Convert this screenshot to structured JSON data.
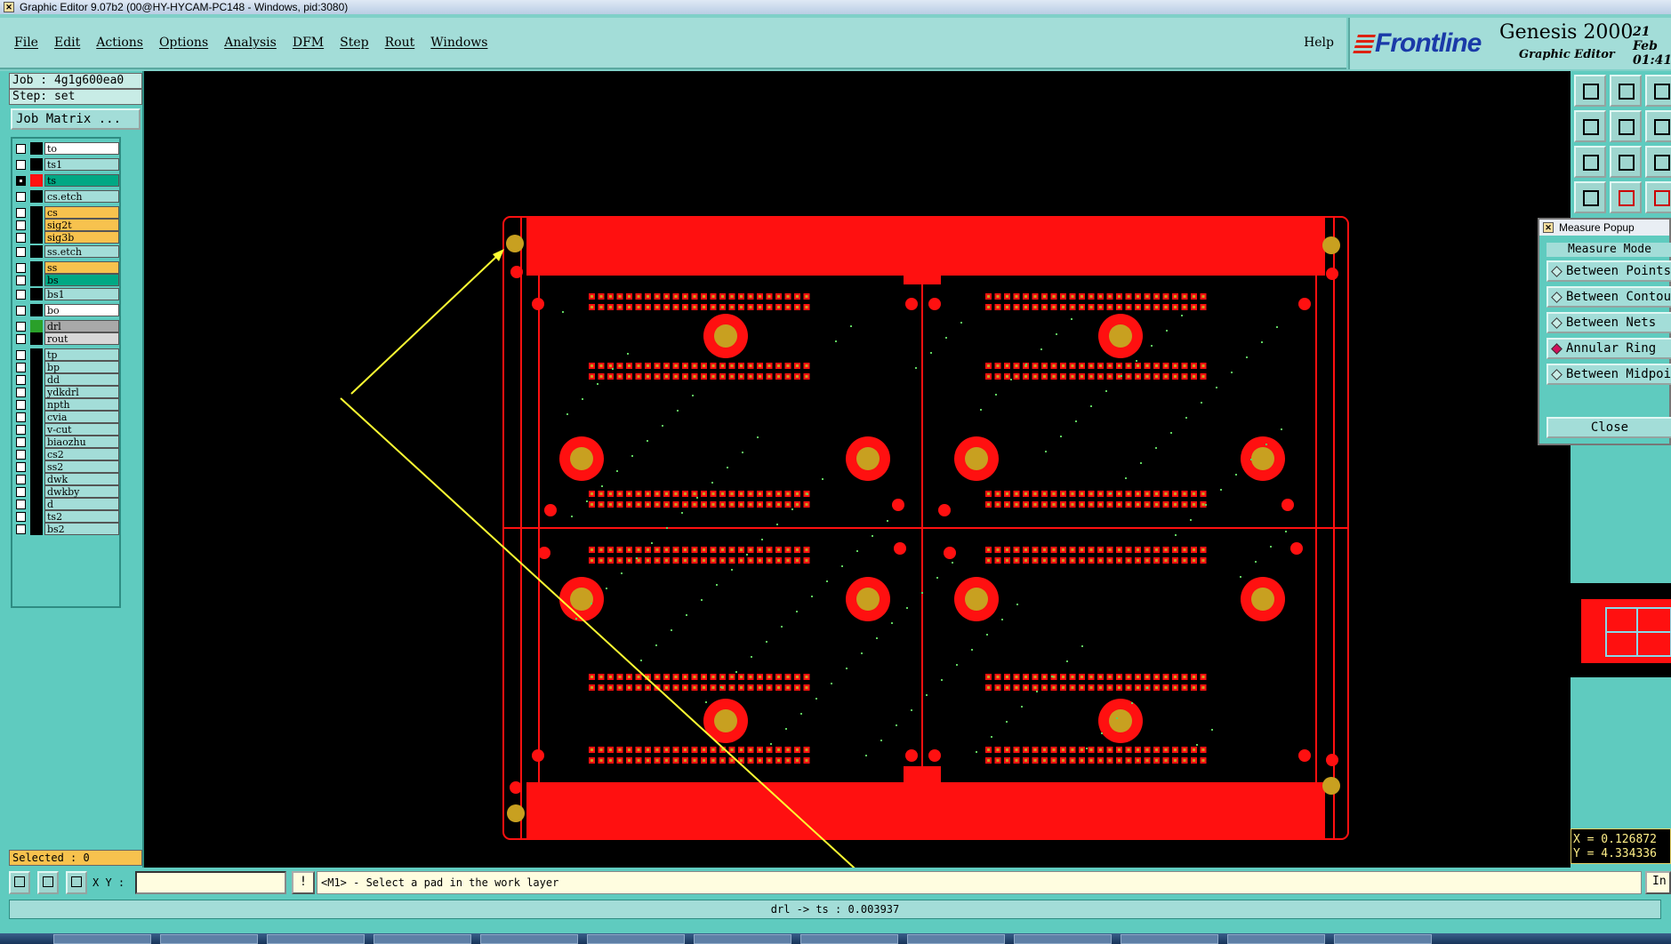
{
  "window": {
    "title": "Graphic Editor 9.07b2 (00@HY-HYCAM-PC148 - Windows, pid:3080)"
  },
  "menu": {
    "items": [
      "File",
      "Edit",
      "Actions",
      "Options",
      "Analysis",
      "DFM",
      "Step",
      "Rout",
      "Windows"
    ],
    "help": "Help"
  },
  "brand": {
    "logo": "Frontline",
    "product": "Genesis 2000",
    "subtitle": "Graphic Editor",
    "date_line1": "21 Feb",
    "date_line2": "01:41"
  },
  "job": {
    "job": "Job : 4g1g600ea0",
    "step": "Step: set",
    "matrix_button": "Job Matrix ..."
  },
  "layers": [
    {
      "name": "to",
      "color": "#ffffff",
      "swatch": "#000000",
      "checked": false
    },
    {
      "name": "ts1",
      "color": "#a3ddd8",
      "swatch": "#000000",
      "checked": false
    },
    {
      "name": "ts",
      "color": "#00a884",
      "swatch": "#ff1010",
      "checked": true
    },
    {
      "name": "cs.etch",
      "color": "#a3ddd8",
      "swatch": "#000000",
      "checked": false
    },
    {
      "name": "cs",
      "color": "#f7c24e",
      "swatch": "#000000",
      "checked": false
    },
    {
      "name": "sig2t",
      "color": "#f7c24e",
      "swatch": "#000000",
      "checked": false
    },
    {
      "name": "sig3b",
      "color": "#f7c24e",
      "swatch": "#000000",
      "checked": false
    },
    {
      "name": "ss.etch",
      "color": "#a3ddd8",
      "swatch": "#000000",
      "checked": false
    },
    {
      "name": "ss",
      "color": "#f7c24e",
      "swatch": "#000000",
      "checked": false
    },
    {
      "name": "bs",
      "color": "#00a884",
      "swatch": "#000000",
      "checked": false
    },
    {
      "name": "bs1",
      "color": "#a3ddd8",
      "swatch": "#000000",
      "checked": false
    },
    {
      "name": "bo",
      "color": "#ffffff",
      "swatch": "#000000",
      "checked": false
    },
    {
      "name": "drl",
      "color": "#a9a9a9",
      "swatch": "#2aa02a",
      "checked": false
    },
    {
      "name": "rout",
      "color": "#d8d8d8",
      "swatch": "#000000",
      "checked": false
    },
    {
      "name": "tp",
      "color": "#a3ddd8",
      "swatch": "#000000",
      "checked": false
    },
    {
      "name": "bp",
      "color": "#a3ddd8",
      "swatch": "#000000",
      "checked": false
    },
    {
      "name": "dd",
      "color": "#a3ddd8",
      "swatch": "#000000",
      "checked": false
    },
    {
      "name": "ydkdrl",
      "color": "#a3ddd8",
      "swatch": "#000000",
      "checked": false
    },
    {
      "name": "npth",
      "color": "#a3ddd8",
      "swatch": "#000000",
      "checked": false
    },
    {
      "name": "cvia",
      "color": "#a3ddd8",
      "swatch": "#000000",
      "checked": false
    },
    {
      "name": "v-cut",
      "color": "#a3ddd8",
      "swatch": "#000000",
      "checked": false
    },
    {
      "name": "biaozhu",
      "color": "#a3ddd8",
      "swatch": "#000000",
      "checked": false
    },
    {
      "name": "cs2",
      "color": "#a3ddd8",
      "swatch": "#000000",
      "checked": false
    },
    {
      "name": "ss2",
      "color": "#a3ddd8",
      "swatch": "#000000",
      "checked": false
    },
    {
      "name": "dwk",
      "color": "#a3ddd8",
      "swatch": "#000000",
      "checked": false
    },
    {
      "name": "dwkby",
      "color": "#a3ddd8",
      "swatch": "#000000",
      "checked": false
    },
    {
      "name": "d",
      "color": "#a3ddd8",
      "swatch": "#000000",
      "checked": false
    },
    {
      "name": "ts2",
      "color": "#a3ddd8",
      "swatch": "#000000",
      "checked": false
    },
    {
      "name": "bs2",
      "color": "#a3ddd8",
      "swatch": "#000000",
      "checked": false
    }
  ],
  "selected": "Selected : 0",
  "measure_popup": {
    "title": "Measure Popup",
    "mode_label": "Measure Mode",
    "options": [
      "Between Points",
      "Between Contours",
      "Between Nets",
      "Annular Ring",
      "Between Midpoints"
    ],
    "active": "Annular Ring",
    "close": "Close"
  },
  "coords": {
    "x": "X = 0.126872",
    "y": "Y = 4.334336"
  },
  "bottom": {
    "xy_label": "X Y :",
    "xy_value": "",
    "warn": "!",
    "prompt": "<M1> - Select a pad in the work layer",
    "prompt_button": "In",
    "status": "drl -> ts : 0.003937"
  },
  "colors": {
    "board": "#ff1010",
    "drill": "#c8a020",
    "annotation": "#ffff33"
  },
  "icons": [
    "close-icon",
    "checkbox-icon",
    "diamond-radio-icon",
    "zoom-icon",
    "snap-icon",
    "grid-icon",
    "warning-icon"
  ]
}
